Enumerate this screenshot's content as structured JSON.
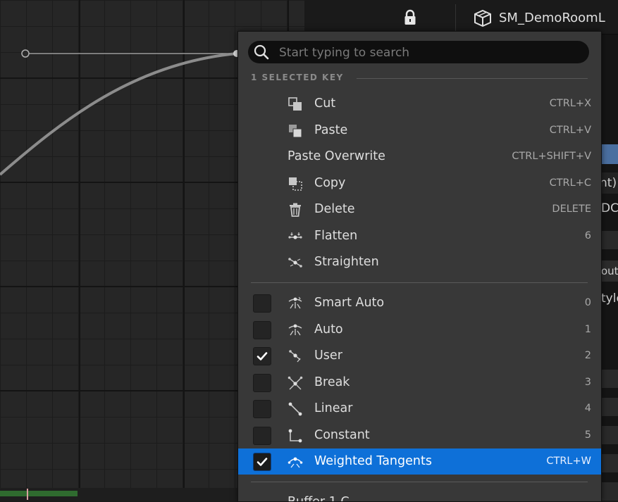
{
  "topbar": {
    "object_name": "SM_DemoRoomL"
  },
  "side_fragments": [
    "nt)",
    "DC",
    "out",
    "tyle"
  ],
  "menu": {
    "search_placeholder": "Start typing to search",
    "section_header": "1 SELECTED KEY",
    "edit_items": [
      {
        "label": "Cut",
        "shortcut": "CTRL+X",
        "icon": "cut-icon"
      },
      {
        "label": "Paste",
        "shortcut": "CTRL+V",
        "icon": "paste-icon"
      },
      {
        "label": "Paste Overwrite",
        "shortcut": "CTRL+SHIFT+V",
        "icon": ""
      },
      {
        "label": "Copy",
        "shortcut": "CTRL+C",
        "icon": "copy-icon"
      },
      {
        "label": "Delete",
        "shortcut": "DELETE",
        "icon": "trash-icon"
      },
      {
        "label": "Flatten",
        "shortcut": "6",
        "icon": "flatten-icon"
      },
      {
        "label": "Straighten",
        "shortcut": "",
        "icon": "straighten-icon"
      }
    ],
    "tangent_items": [
      {
        "label": "Smart Auto",
        "shortcut": "0",
        "checked": false,
        "icon": "smart-auto-tangent-icon"
      },
      {
        "label": "Auto",
        "shortcut": "1",
        "checked": false,
        "icon": "auto-tangent-icon"
      },
      {
        "label": "User",
        "shortcut": "2",
        "checked": true,
        "icon": "user-tangent-icon"
      },
      {
        "label": "Break",
        "shortcut": "3",
        "checked": false,
        "icon": "break-tangent-icon"
      },
      {
        "label": "Linear",
        "shortcut": "4",
        "checked": false,
        "icon": "linear-tangent-icon"
      },
      {
        "label": "Constant",
        "shortcut": "5",
        "checked": false,
        "icon": "constant-tangent-icon"
      },
      {
        "label": "Weighted Tangents",
        "shortcut": "CTRL+W",
        "checked": true,
        "icon": "weighted-tangents-icon",
        "highlighted": true
      }
    ],
    "bottom_item_partial": "Buffer 1 C"
  },
  "colors": {
    "highlight": "#0e70d8",
    "menu_bg": "#383838",
    "timeline_fill": "#2f6b2f"
  }
}
